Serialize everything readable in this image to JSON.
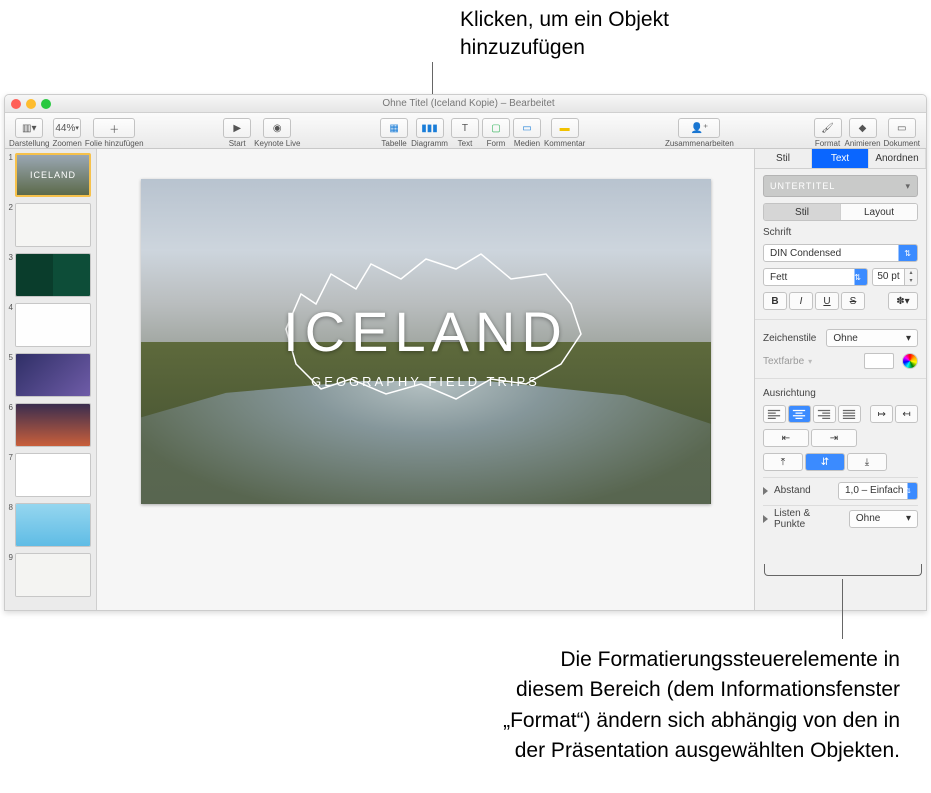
{
  "callouts": {
    "top": "Klicken, um ein Objekt\nhinzuzufügen",
    "bottom": "Die Formatierungssteuerelemente in\ndiesem Bereich (dem Informationsfenster\n„Format“) ändern sich abhängig von den in\nder Präsentation ausgewählten Objekten."
  },
  "titlebar": {
    "title": "Ohne Titel (Iceland Kopie) – Bearbeitet"
  },
  "toolbar": {
    "left": {
      "view": "Darstellung",
      "zoom": "44%",
      "zoom_lbl": "Zoomen",
      "add_slide": "Folie hinzufügen"
    },
    "play": {
      "start": "Start",
      "live": "Keynote Live"
    },
    "insert": {
      "table": "Tabelle",
      "chart": "Diagramm",
      "text": "Text",
      "shape": "Form",
      "media": "Medien",
      "comment": "Kommentar"
    },
    "collab": "Zusammenarbeiten",
    "right": {
      "format": "Format",
      "animate": "Animieren",
      "document": "Dokument"
    }
  },
  "thumbs": {
    "labels": [
      "1",
      "2",
      "3",
      "4",
      "5",
      "6",
      "7",
      "8",
      "9"
    ],
    "selected": 1
  },
  "slide": {
    "title": "ICELAND",
    "subtitle": "GEOGRAPHY FIELD TRIPS"
  },
  "inspector": {
    "tabs": {
      "style": "Stil",
      "text": "Text",
      "arrange": "Anordnen"
    },
    "paragraph_style": "UNTERTITEL",
    "subtabs": {
      "style": "Stil",
      "layout": "Layout"
    },
    "font": {
      "label": "Schrift",
      "family": "DIN Condensed",
      "weight": "Fett",
      "size": "50",
      "size_unit": "pt"
    },
    "biu": {
      "b": "B",
      "i": "I",
      "u": "U",
      "s": "S"
    },
    "gear": "✽",
    "charstyle": {
      "label": "Zeichenstile",
      "value": "Ohne"
    },
    "color": {
      "label": "Textfarbe"
    },
    "align": {
      "label": "Ausrichtung"
    },
    "spacing": {
      "label": "Abstand",
      "value": "1,0 – Einfach"
    },
    "bullets": {
      "label": "Listen & Punkte",
      "value": "Ohne"
    }
  }
}
